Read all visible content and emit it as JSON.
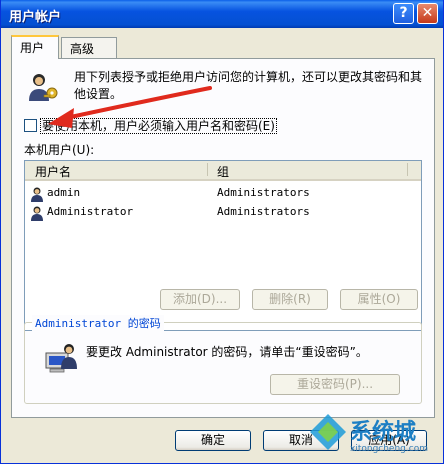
{
  "window": {
    "title": "用户帐户",
    "help_glyph": "?",
    "close_glyph": "✕"
  },
  "tabs": [
    {
      "label": "用户"
    },
    {
      "label": "高级"
    }
  ],
  "intro": {
    "text": "用下列表授予或拒绝用户访问您的计算机，还可以更改其密码和其他设置。"
  },
  "require_login": {
    "label": "要使用本机，用户必须输入用户名和密码(E)",
    "checked": false
  },
  "users_list": {
    "label": "本机用户(U):",
    "columns": [
      "用户名",
      "组"
    ],
    "rows": [
      {
        "name": "admin",
        "group": "Administrators"
      },
      {
        "name": "Administrator",
        "group": "Administrators"
      }
    ]
  },
  "list_buttons": {
    "add": "添加(D)...",
    "remove": "删除(R)",
    "properties": "属性(O)"
  },
  "password_group": {
    "title": "Administrator 的密码",
    "text": "要更改 Administrator 的密码，请单击“重设密码”。",
    "reset_button": "重设密码(P)..."
  },
  "dialog_buttons": {
    "ok": "确定",
    "cancel": "取消",
    "apply": "应用(A)"
  },
  "watermark": {
    "brand": "系统城",
    "url": "xitongcheng.com"
  }
}
